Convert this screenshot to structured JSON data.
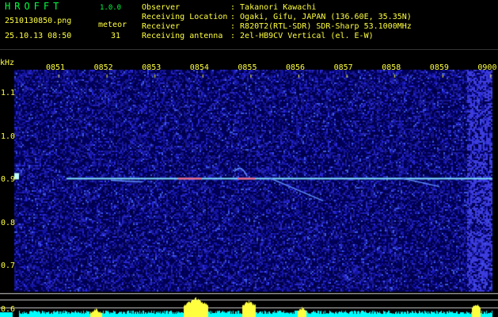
{
  "header": {
    "app_title": "HROFFT",
    "app_version": "1.0.0",
    "filename": "2510130850.png",
    "timestamp": "25.10.13 08:50",
    "meteor_label": "meteor",
    "meteor_count": "31"
  },
  "info": [
    {
      "key": "Observer",
      "value": ": Takanori Kawachi"
    },
    {
      "key": "Receiving Location",
      "value": ": Ogaki, Gifu, JAPAN (136.60E, 35.35N)"
    },
    {
      "key": "Receiver",
      "value": ": R820T2(RTL-SDR) SDR-Sharp 53.1000MHz"
    },
    {
      "key": "Receiving antenna",
      "value": ": 2el-HB9CV Vertical (el. E-W)"
    }
  ],
  "chart_data": {
    "type": "heatmap",
    "ylabel": "kHz",
    "time_labels": [
      "0851",
      "0852",
      "0853",
      "0854",
      "0855",
      "0856",
      "0857",
      "0858",
      "0859",
      "0900"
    ],
    "freq_labels": [
      "1.1",
      "1.0",
      "0.9",
      "0.8",
      "0.7",
      "0.6"
    ],
    "ylim": [
      0.59,
      1.17
    ],
    "carrier_khz": 0.905,
    "colors": {
      "text_green": "#00ff40",
      "text_yellow": "#ffff40",
      "background": "#000060",
      "carrier": "#80e0ff",
      "level_bars": "#00ffff",
      "level_peaks": "#ffff40"
    }
  }
}
